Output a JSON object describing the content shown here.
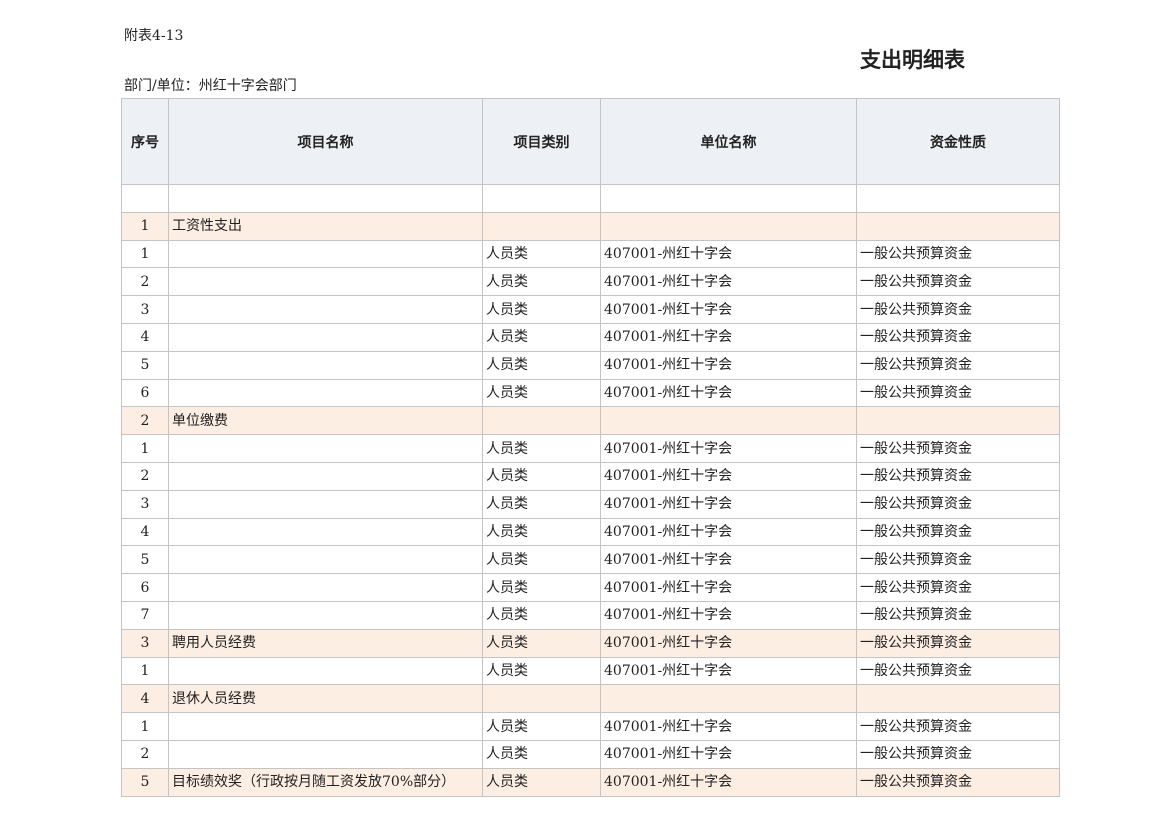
{
  "appendix_label": "附表4-13",
  "title": "支出明细表",
  "department_line": "部门/单位：州红十字会部门",
  "table": {
    "headers": {
      "seq": "序号",
      "project_name": "项目名称",
      "project_category": "项目类别",
      "unit_name": "单位名称",
      "fund_nature": "资金性质"
    },
    "rows": [
      {
        "kind": "blank",
        "seq": "",
        "name": "",
        "category": "",
        "unit": "",
        "fund": ""
      },
      {
        "kind": "group",
        "seq": "1",
        "name": "工资性支出",
        "category": "",
        "unit": "",
        "fund": ""
      },
      {
        "kind": "item",
        "seq": "1",
        "name": "",
        "category": "人员类",
        "unit": "407001-州红十字会",
        "fund": "一般公共预算资金"
      },
      {
        "kind": "item",
        "seq": "2",
        "name": "",
        "category": "人员类",
        "unit": "407001-州红十字会",
        "fund": "一般公共预算资金"
      },
      {
        "kind": "item",
        "seq": "3",
        "name": "",
        "category": "人员类",
        "unit": "407001-州红十字会",
        "fund": "一般公共预算资金"
      },
      {
        "kind": "item",
        "seq": "4",
        "name": "",
        "category": "人员类",
        "unit": "407001-州红十字会",
        "fund": "一般公共预算资金"
      },
      {
        "kind": "item",
        "seq": "5",
        "name": "",
        "category": "人员类",
        "unit": "407001-州红十字会",
        "fund": "一般公共预算资金"
      },
      {
        "kind": "item",
        "seq": "6",
        "name": "",
        "category": "人员类",
        "unit": "407001-州红十字会",
        "fund": "一般公共预算资金"
      },
      {
        "kind": "group",
        "seq": "2",
        "name": "单位缴费",
        "category": "",
        "unit": "",
        "fund": ""
      },
      {
        "kind": "item",
        "seq": "1",
        "name": "",
        "category": "人员类",
        "unit": "407001-州红十字会",
        "fund": "一般公共预算资金"
      },
      {
        "kind": "item",
        "seq": "2",
        "name": "",
        "category": "人员类",
        "unit": "407001-州红十字会",
        "fund": "一般公共预算资金"
      },
      {
        "kind": "item",
        "seq": "3",
        "name": "",
        "category": "人员类",
        "unit": "407001-州红十字会",
        "fund": "一般公共预算资金"
      },
      {
        "kind": "item",
        "seq": "4",
        "name": "",
        "category": "人员类",
        "unit": "407001-州红十字会",
        "fund": "一般公共预算资金"
      },
      {
        "kind": "item",
        "seq": "5",
        "name": "",
        "category": "人员类",
        "unit": "407001-州红十字会",
        "fund": "一般公共预算资金"
      },
      {
        "kind": "item",
        "seq": "6",
        "name": "",
        "category": "人员类",
        "unit": "407001-州红十字会",
        "fund": "一般公共预算资金"
      },
      {
        "kind": "item",
        "seq": "7",
        "name": "",
        "category": "人员类",
        "unit": "407001-州红十字会",
        "fund": "一般公共预算资金"
      },
      {
        "kind": "group",
        "seq": "3",
        "name": "聘用人员经费",
        "category": "人员类",
        "unit": "407001-州红十字会",
        "fund": "一般公共预算资金"
      },
      {
        "kind": "item",
        "seq": "1",
        "name": "",
        "category": "人员类",
        "unit": "407001-州红十字会",
        "fund": "一般公共预算资金"
      },
      {
        "kind": "group",
        "seq": "4",
        "name": "退休人员经费",
        "category": "",
        "unit": "",
        "fund": ""
      },
      {
        "kind": "item",
        "seq": "1",
        "name": "",
        "category": "人员类",
        "unit": "407001-州红十字会",
        "fund": "一般公共预算资金"
      },
      {
        "kind": "item",
        "seq": "2",
        "name": "",
        "category": "人员类",
        "unit": "407001-州红十字会",
        "fund": "一般公共预算资金"
      },
      {
        "kind": "group",
        "seq": "5",
        "name": "目标绩效奖（行政按月随工资发放70%部分）",
        "category": "人员类",
        "unit": "407001-州红十字会",
        "fund": "一般公共预算资金"
      }
    ]
  }
}
